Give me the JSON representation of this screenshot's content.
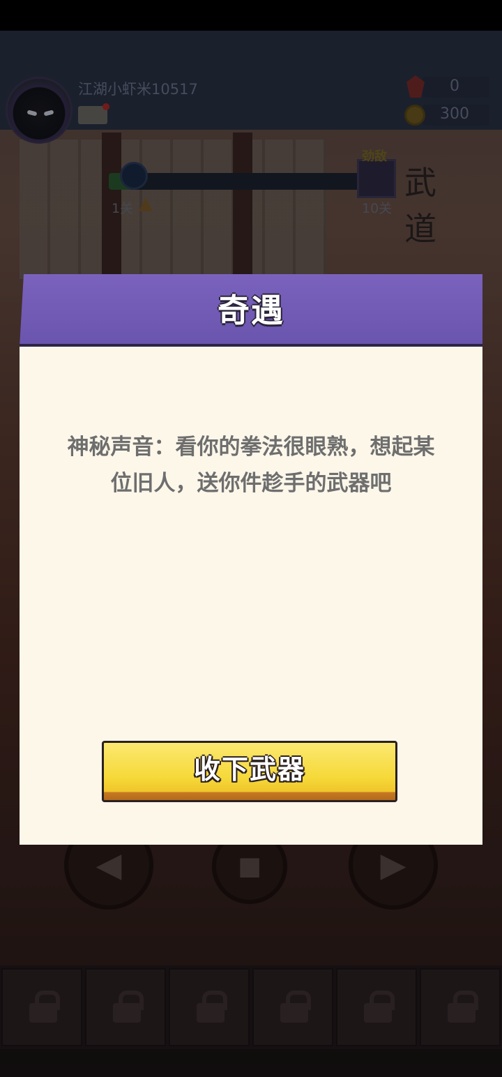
{
  "player": {
    "name": "江湖小虾米10517"
  },
  "resources": {
    "gems": "0",
    "coins": "300"
  },
  "stage_progress": {
    "current_label": "1关",
    "boss_label": "10关",
    "boss_tag": "劲敌",
    "progress_fraction": 0.08
  },
  "dojo_sign": "武道",
  "dialog": {
    "title": "奇遇",
    "message": "神秘声音：看你的拳法很眼熟，想起某位旧人，送你件趁手的武器吧",
    "confirm_label": "收下武器"
  },
  "colors": {
    "dialog_header": "#6a55ae",
    "dialog_body": "#fdf7ea",
    "confirm_button": "#f6d93a"
  },
  "icons": [
    "avatar-icon",
    "mail-icon",
    "gem-icon",
    "coin-icon",
    "flag-icon",
    "lock-icon"
  ]
}
